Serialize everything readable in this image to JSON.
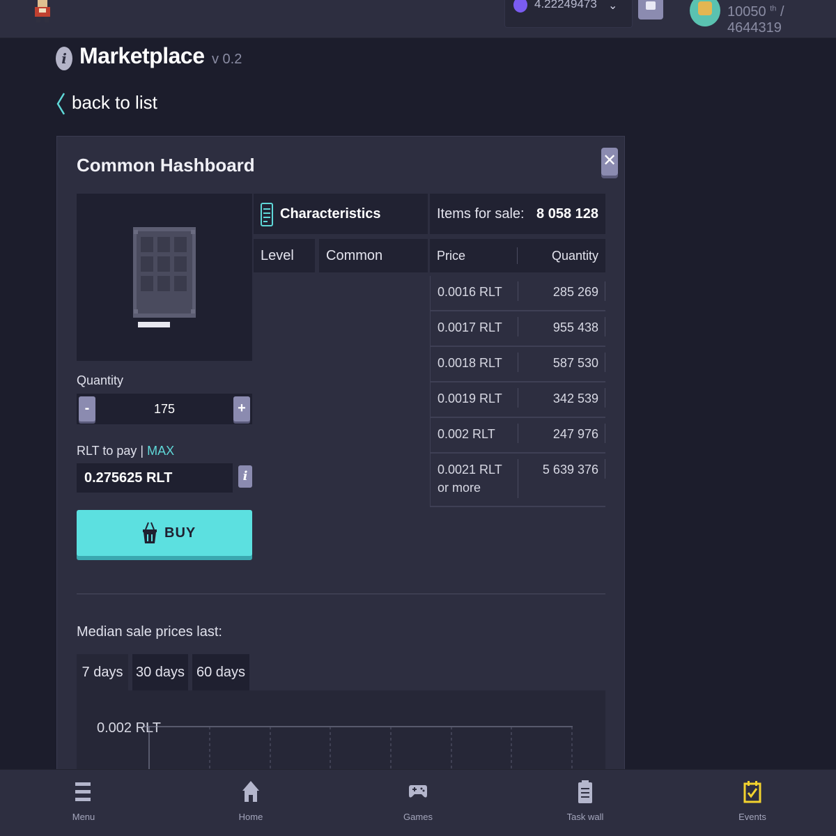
{
  "topbar": {
    "balance": "4.22249473",
    "rank_position": "10050",
    "rank_suffix": "th",
    "rank_total": "/ 4644319"
  },
  "header": {
    "title": "Marketplace",
    "version": "v 0.2",
    "back_label": "back to list"
  },
  "item": {
    "name": "Common Hashboard",
    "quantity_label": "Quantity",
    "quantity_value": "175",
    "qty_minus": "-",
    "qty_plus": "+",
    "pay_label": "RLT to pay |",
    "max_label": "MAX",
    "pay_value": "0.275625 RLT",
    "buy_label": "BUY"
  },
  "characteristics": {
    "title": "Characteristics",
    "rows": [
      {
        "label": "Level",
        "value": "Common"
      }
    ]
  },
  "sale": {
    "items_for_sale_label": "Items for sale:",
    "items_for_sale_value": "8 058 128",
    "col_price": "Price",
    "col_quantity": "Quantity",
    "rows": [
      {
        "price": "0.0016 RLT",
        "quantity": "285 269"
      },
      {
        "price": "0.0017 RLT",
        "quantity": "955 438"
      },
      {
        "price": "0.0018 RLT",
        "quantity": "587 530"
      },
      {
        "price": "0.0019 RLT",
        "quantity": "342 539"
      },
      {
        "price": "0.002 RLT",
        "quantity": "247 976"
      },
      {
        "price": "0.0021 RLT or more",
        "quantity": "5 639 376"
      }
    ]
  },
  "median": {
    "label": "Median sale prices last:",
    "tabs": [
      "7 days",
      "30 days",
      "60 days"
    ],
    "active_tab": 0,
    "y_tick": "0.002 RLT"
  },
  "bottom_nav": [
    {
      "label": "Menu",
      "icon": "menu-icon"
    },
    {
      "label": "Home",
      "icon": "home-icon"
    },
    {
      "label": "Games",
      "icon": "gamepad-icon"
    },
    {
      "label": "Task wall",
      "icon": "clipboard-icon"
    },
    {
      "label": "Events",
      "icon": "calendar-check-icon"
    }
  ],
  "colors": {
    "accent": "#5ce0e0",
    "events_icon": "#f2d22e"
  }
}
